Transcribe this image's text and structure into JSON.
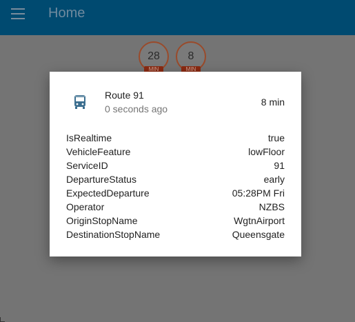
{
  "appbar": {
    "title": "Home"
  },
  "badges": [
    {
      "value": "28",
      "unit": "MIN"
    },
    {
      "value": "8",
      "unit": "MIN"
    }
  ],
  "dialog": {
    "route": "Route 91",
    "updated": "0 seconds ago",
    "eta": "8 min",
    "properties": [
      {
        "key": "IsRealtime",
        "value": "true"
      },
      {
        "key": "VehicleFeature",
        "value": "lowFloor"
      },
      {
        "key": "ServiceID",
        "value": "91"
      },
      {
        "key": "DepartureStatus",
        "value": "early"
      },
      {
        "key": "ExpectedDeparture",
        "value": "05:28PM Fri"
      },
      {
        "key": "Operator",
        "value": "NZBS"
      },
      {
        "key": "OriginStopName",
        "value": "WgtnAirport"
      },
      {
        "key": "DestinationStopName",
        "value": "Queensgate"
      }
    ]
  }
}
